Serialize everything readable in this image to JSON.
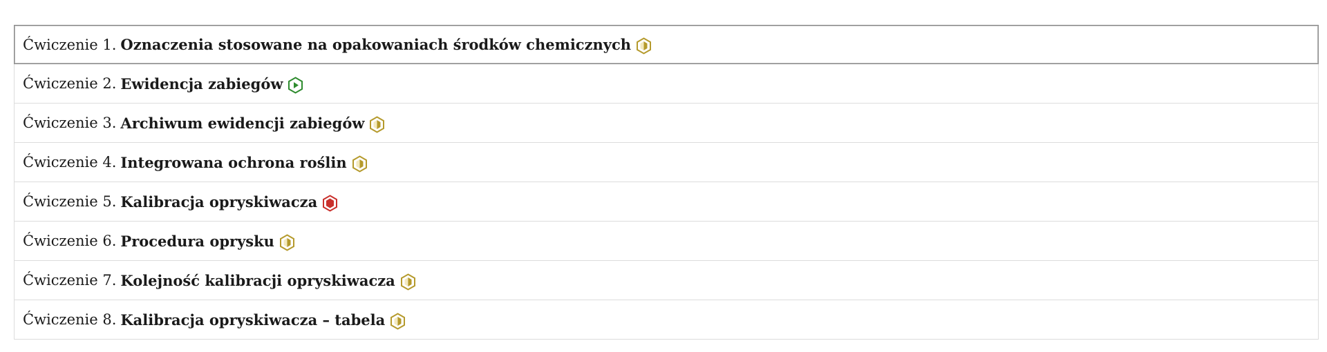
{
  "exercises": [
    {
      "prefix": "Ćwiczenie 1.",
      "title": "Oznaczenia stosowane na opakowaniach środków chemicznych",
      "status": "partial",
      "icon": "half-hexagon-icon",
      "color": "#b59a2c"
    },
    {
      "prefix": "Ćwiczenie 2.",
      "title": "Ewidencja zabiegów",
      "status": "started",
      "icon": "play-hexagon-icon",
      "color": "#2e8b2e"
    },
    {
      "prefix": "Ćwiczenie 3.",
      "title": "Archiwum ewidencji zabiegów",
      "status": "partial",
      "icon": "half-hexagon-icon",
      "color": "#b59a2c"
    },
    {
      "prefix": "Ćwiczenie 4.",
      "title": "Integrowana ochrona roślin",
      "status": "partial",
      "icon": "half-hexagon-icon",
      "color": "#b59a2c"
    },
    {
      "prefix": "Ćwiczenie 5.",
      "title": "Kalibracja opryskiwacza",
      "status": "failed",
      "icon": "filled-hexagon-icon",
      "color": "#c9302c"
    },
    {
      "prefix": "Ćwiczenie 6.",
      "title": "Procedura oprysku",
      "status": "partial",
      "icon": "half-hexagon-icon",
      "color": "#b59a2c"
    },
    {
      "prefix": "Ćwiczenie 7.",
      "title": "Kolejność kalibracji opryskiwacza",
      "status": "partial",
      "icon": "half-hexagon-icon",
      "color": "#b59a2c"
    },
    {
      "prefix": "Ćwiczenie 8.",
      "title": "Kalibracja opryskiwacza – tabela",
      "status": "partial",
      "icon": "half-hexagon-icon",
      "color": "#b59a2c"
    }
  ],
  "selected_index": 0
}
